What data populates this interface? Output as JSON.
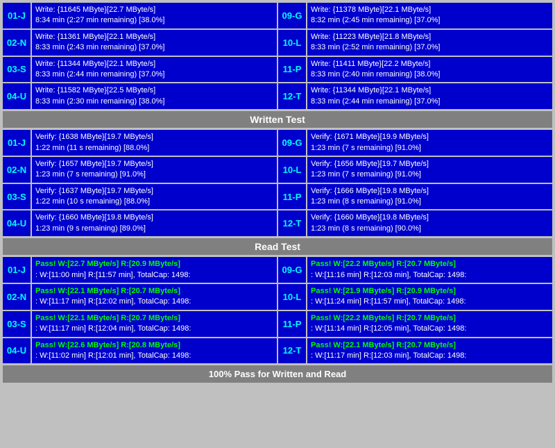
{
  "sections": {
    "write_test": {
      "label": "Written Test",
      "rows": [
        {
          "left": {
            "id": "01-J",
            "line1": "Write: {11645 MByte}[22.7 MByte/s]",
            "line2": "8:34 min (2:27 min remaining)  [38.0%]"
          },
          "right": {
            "id": "09-G",
            "line1": "Write: {11378 MByte}[22.1 MByte/s]",
            "line2": "8:32 min (2:45 min remaining)  [37.0%]"
          }
        },
        {
          "left": {
            "id": "02-N",
            "line1": "Write: {11361 MByte}[22.1 MByte/s]",
            "line2": "8:33 min (2:43 min remaining)  [37.0%]"
          },
          "right": {
            "id": "10-L",
            "line1": "Write: {11223 MByte}[21.8 MByte/s]",
            "line2": "8:33 min (2:52 min remaining)  [37.0%]"
          }
        },
        {
          "left": {
            "id": "03-S",
            "line1": "Write: {11344 MByte}[22.1 MByte/s]",
            "line2": "8:33 min (2:44 min remaining)  [37.0%]"
          },
          "right": {
            "id": "11-P",
            "line1": "Write: {11411 MByte}[22.2 MByte/s]",
            "line2": "8:33 min (2:40 min remaining)  [38.0%]"
          }
        },
        {
          "left": {
            "id": "04-U",
            "line1": "Write: {11582 MByte}[22.5 MByte/s]",
            "line2": "8:33 min (2:30 min remaining)  [38.0%]"
          },
          "right": {
            "id": "12-T",
            "line1": "Write: {11344 MByte}[22.1 MByte/s]",
            "line2": "8:33 min (2:44 min remaining)  [37.0%]"
          }
        }
      ]
    },
    "verify_test": {
      "label": "Written Test",
      "rows": [
        {
          "left": {
            "id": "01-J",
            "line1": "Verify: {1638 MByte}[19.7 MByte/s]",
            "line2": "1:22 min (11 s remaining)   [88.0%]"
          },
          "right": {
            "id": "09-G",
            "line1": "Verify: {1671 MByte}[19.9 MByte/s]",
            "line2": "1:23 min (7 s remaining)   [91.0%]"
          }
        },
        {
          "left": {
            "id": "02-N",
            "line1": "Verify: {1657 MByte}[19.7 MByte/s]",
            "line2": "1:23 min (7 s remaining)   [91.0%]"
          },
          "right": {
            "id": "10-L",
            "line1": "Verify: {1656 MByte}[19.7 MByte/s]",
            "line2": "1:23 min (7 s remaining)   [91.0%]"
          }
        },
        {
          "left": {
            "id": "03-S",
            "line1": "Verify: {1637 MByte}[19.7 MByte/s]",
            "line2": "1:22 min (10 s remaining)   [88.0%]"
          },
          "right": {
            "id": "11-P",
            "line1": "Verify: {1666 MByte}[19.8 MByte/s]",
            "line2": "1:23 min (8 s remaining)   [91.0%]"
          }
        },
        {
          "left": {
            "id": "04-U",
            "line1": "Verify: {1660 MByte}[19.8 MByte/s]",
            "line2": "1:23 min (9 s remaining)   [89.0%]"
          },
          "right": {
            "id": "12-T",
            "line1": "Verify: {1660 MByte}[19.8 MByte/s]",
            "line2": "1:23 min (8 s remaining)   [90.0%]"
          }
        }
      ]
    },
    "read_test": {
      "label": "Read Test",
      "rows": [
        {
          "left": {
            "id": "01-J",
            "pass": "Pass!",
            "line1": "W:[22.7 MByte/s] R:[20.9 MByte/s]",
            "line2": ": W:[11:00 min] R:[11:57 min], TotalCap: 1498:"
          },
          "right": {
            "id": "09-G",
            "pass": "Pass!",
            "line1": "W:[22.2 MByte/s] R:[20.7 MByte/s]",
            "line2": ": W:[11:16 min] R:[12:03 min], TotalCap: 1498:"
          }
        },
        {
          "left": {
            "id": "02-N",
            "pass": "Pass!",
            "line1": "W:[22.1 MByte/s] R:[20.7 MByte/s]",
            "line2": ": W:[11:17 min] R:[12:02 min], TotalCap: 1498:"
          },
          "right": {
            "id": "10-L",
            "pass": "Pass!",
            "line1": "W:[21.9 MByte/s] R:[20.9 MByte/s]",
            "line2": ": W:[11:24 min] R:[11:57 min], TotalCap: 1498:"
          }
        },
        {
          "left": {
            "id": "03-S",
            "pass": "Pass!",
            "line1": "W:[22.1 MByte/s] R:[20.7 MByte/s]",
            "line2": ": W:[11:17 min] R:[12:04 min], TotalCap: 1498:"
          },
          "right": {
            "id": "11-P",
            "pass": "Pass!",
            "line1": "W:[22.2 MByte/s] R:[20.7 MByte/s]",
            "line2": ": W:[11:14 min] R:[12:05 min], TotalCap: 1498:"
          }
        },
        {
          "left": {
            "id": "04-U",
            "pass": "Pass!",
            "line1": "W:[22.6 MByte/s] R:[20.8 MByte/s]",
            "line2": ": W:[11:02 min] R:[12:01 min], TotalCap: 1498:"
          },
          "right": {
            "id": "12-T",
            "pass": "Pass!",
            "line1": "W:[22.1 MByte/s] R:[20.7 MByte/s]",
            "line2": ": W:[11:17 min] R:[12:03 min], TotalCap: 1498:"
          }
        }
      ]
    }
  },
  "labels": {
    "written_test": "Written Test",
    "read_test": "Read Test",
    "bottom": "100% Pass for Written and Read"
  }
}
